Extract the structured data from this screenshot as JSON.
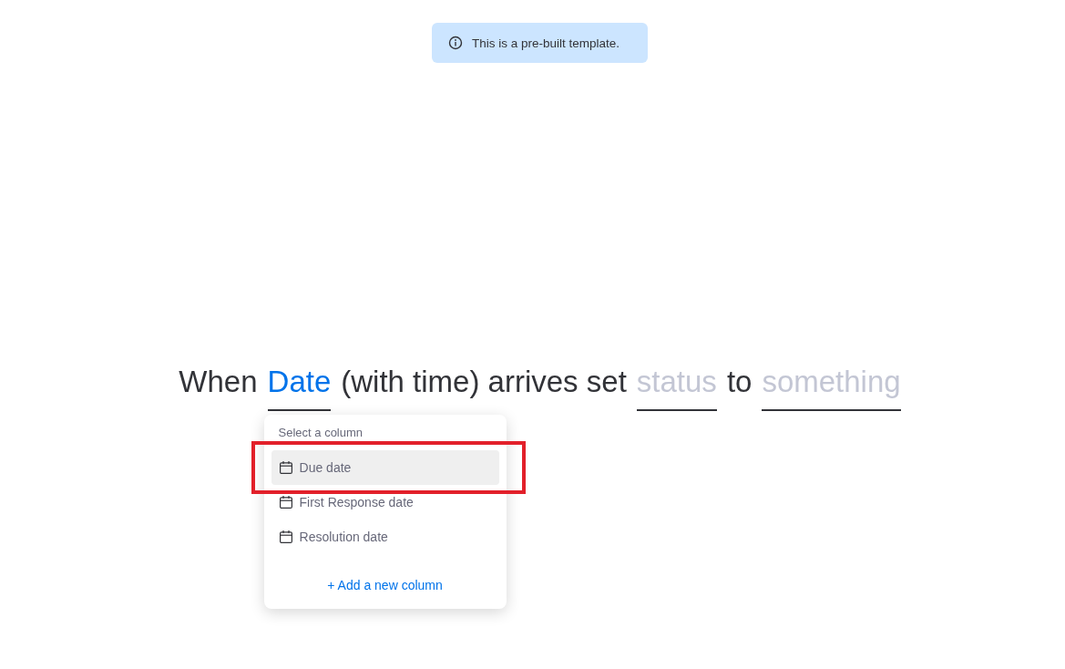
{
  "notice": {
    "text": "This is a pre-built template."
  },
  "sentence": [
    {
      "kind": "text",
      "text": "When"
    },
    {
      "kind": "blank",
      "text": "Date",
      "filled": true,
      "dropdown": {
        "heading": "Select a column",
        "items": [
          {
            "label": "Due date",
            "selected": true,
            "highlighted": true
          },
          {
            "label": "First Response date",
            "selected": false,
            "highlighted": false
          },
          {
            "label": "Resolution date",
            "selected": false,
            "highlighted": false
          }
        ],
        "add_link": "+ Add a new column"
      }
    },
    {
      "kind": "text",
      "text": "(with time) arrives set"
    },
    {
      "kind": "blank",
      "text": "status",
      "filled": false
    },
    {
      "kind": "text",
      "text": "to"
    },
    {
      "kind": "blank",
      "text": "something",
      "filled": false
    }
  ]
}
